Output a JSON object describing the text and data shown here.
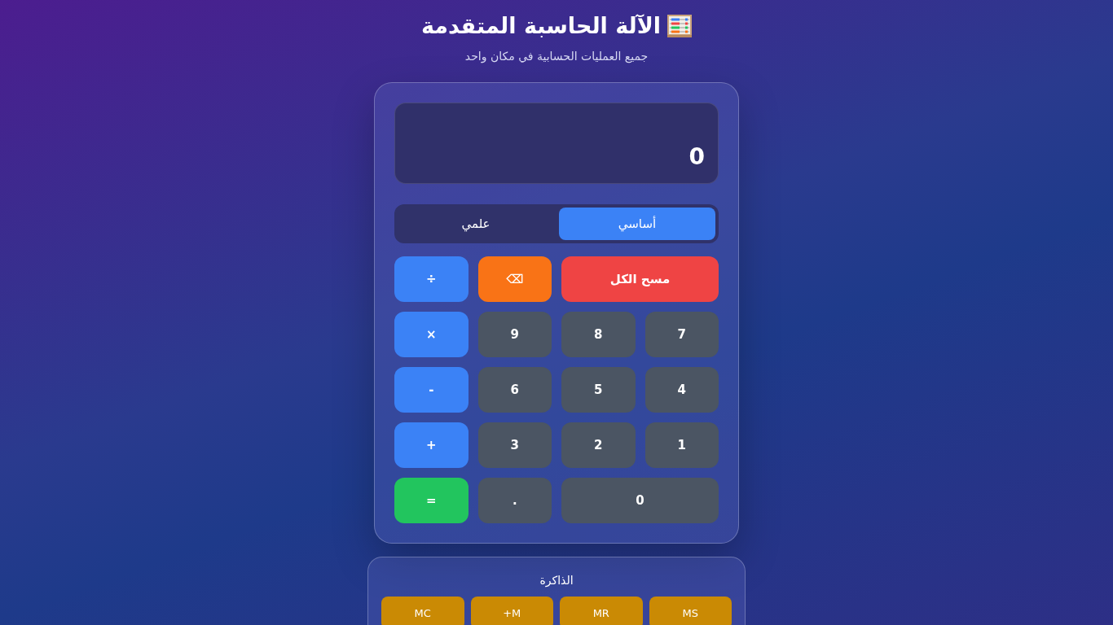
{
  "header": {
    "title": "الآلة الحاسبة المتقدمة",
    "subtitle": "جميع العمليات الحسابية في مكان واحد"
  },
  "display": {
    "value": "0"
  },
  "modes": [
    {
      "label": "أساسي",
      "selected": true
    },
    {
      "label": "علمي",
      "selected": false
    }
  ],
  "keys": [
    {
      "label": "مسح الكل",
      "kind": "clear"
    },
    {
      "label": "⌫",
      "kind": "backspace"
    },
    {
      "label": "÷",
      "kind": "operator"
    },
    {
      "label": "7",
      "kind": "digit"
    },
    {
      "label": "8",
      "kind": "digit"
    },
    {
      "label": "9",
      "kind": "digit"
    },
    {
      "label": "×",
      "kind": "operator"
    },
    {
      "label": "4",
      "kind": "digit"
    },
    {
      "label": "5",
      "kind": "digit"
    },
    {
      "label": "6",
      "kind": "digit"
    },
    {
      "label": "-",
      "kind": "operator"
    },
    {
      "label": "1",
      "kind": "digit"
    },
    {
      "label": "2",
      "kind": "digit"
    },
    {
      "label": "3",
      "kind": "digit"
    },
    {
      "label": "+",
      "kind": "operator"
    },
    {
      "label": "0",
      "kind": "zero"
    },
    {
      "label": ".",
      "kind": "digit"
    },
    {
      "label": "=",
      "kind": "equals"
    }
  ],
  "memory": {
    "title": "الذاكرة",
    "buttons": [
      "MS",
      "MR",
      "+M",
      "MC"
    ]
  }
}
